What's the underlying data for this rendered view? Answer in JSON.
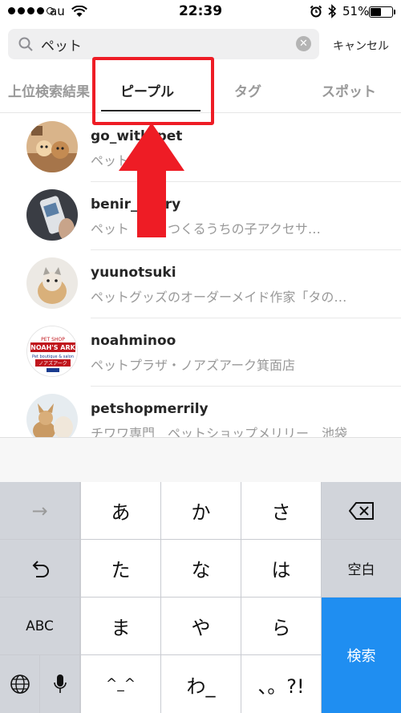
{
  "status_bar": {
    "carrier": "au",
    "time": "22:39",
    "battery_percent": "51%",
    "battery_level": 0.51
  },
  "search": {
    "query": "ペット",
    "cancel_label": "キャンセル"
  },
  "tabs": [
    {
      "label": "上位検索結果"
    },
    {
      "label": "ピープル"
    },
    {
      "label": "タグ"
    },
    {
      "label": "スポット"
    }
  ],
  "active_tab": "ピープル",
  "results": [
    {
      "username": "go_with_pet",
      "description": "ペット【公式】"
    },
    {
      "username": "benir_livery",
      "description": "ペット　からつくるうちの子アクセサ…"
    },
    {
      "username": "yuunotsuki",
      "description": "ペットグッズのオーダーメイド作家「タの…"
    },
    {
      "username": "noahminoo",
      "description": "ペットプラザ・ノアズアーク箕面店"
    },
    {
      "username": "petshopmerrily",
      "description": "チワワ専門　ペットショップメリリー　池袋"
    }
  ],
  "avatar4_text": {
    "line1": "PET SHOP",
    "line2": "NOAH'S ARK",
    "line3": "Pet boutique & salon",
    "line4": "ノアズアーク"
  },
  "keyboard": {
    "row1": [
      "→",
      "あ",
      "か",
      "さ",
      "⌫"
    ],
    "row2": [
      "↺",
      "た",
      "な",
      "は",
      "空白"
    ],
    "row3": [
      "ABC",
      "ま",
      "や",
      "ら"
    ],
    "row4": [
      "🌐",
      "🎤",
      "^_^",
      "わ_",
      "、。?!"
    ],
    "search_key": "検索"
  },
  "colors": {
    "highlight": "#ee1c25",
    "keyboard_blue": "#1f8ef1"
  }
}
